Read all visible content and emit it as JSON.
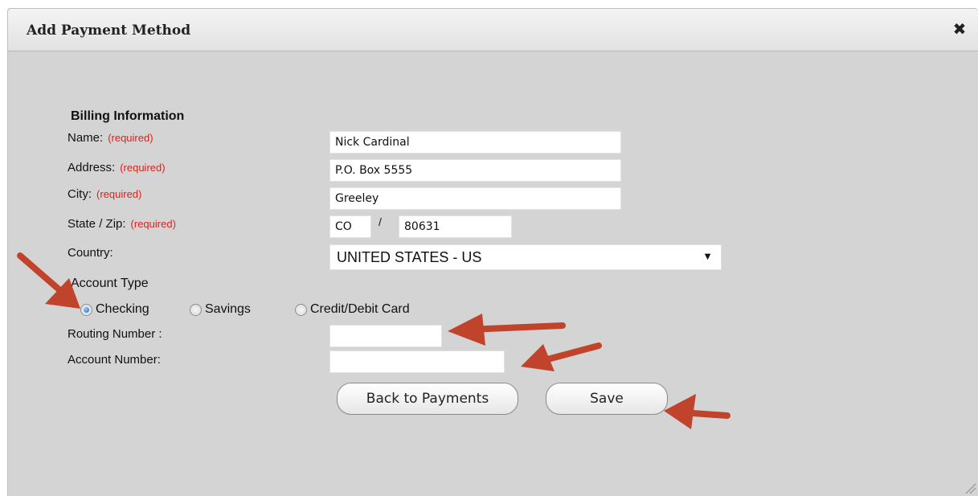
{
  "dialog": {
    "title": "Add Payment Method",
    "close_icon": "close-icon"
  },
  "billing": {
    "section_title": "Billing Information",
    "required_text": "(required)",
    "name_label": "Name:",
    "name_value": "Nick Cardinal",
    "address_label": "Address:",
    "address_value": "P.O. Box 5555",
    "city_label": "City:",
    "city_value": "Greeley",
    "state_zip_label": "State / Zip:",
    "state_value": "CO",
    "zip_separator": "/",
    "zip_value": "80631",
    "country_label": "Country:",
    "country_value": "UNITED STATES - US"
  },
  "account": {
    "type_label": "Account Type",
    "options": [
      "Checking",
      "Savings",
      "Credit/Debit Card"
    ],
    "selected": "Checking",
    "routing_label": "Routing Number :",
    "routing_value": "",
    "account_label": "Account Number:",
    "account_value": ""
  },
  "buttons": {
    "back_label": "Back to Payments",
    "save_label": "Save"
  },
  "colors": {
    "annotation_arrow": "#c0432b",
    "required": "#e0201c"
  }
}
